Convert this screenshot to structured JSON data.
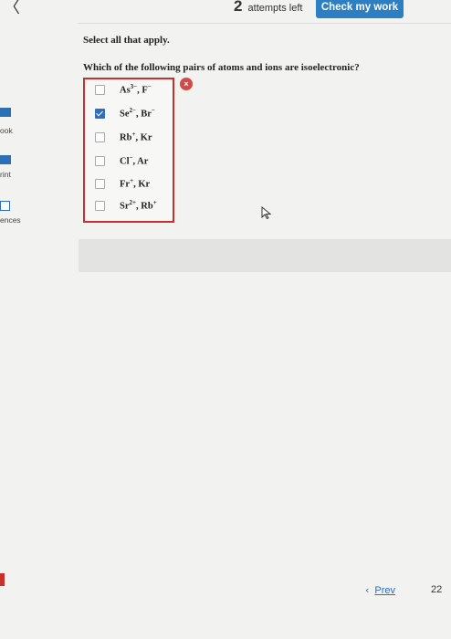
{
  "header": {
    "attempts_count": "2",
    "attempts_label": "attempts left",
    "check_button": "Check my work"
  },
  "sidebar": {
    "items": [
      {
        "label": "ook",
        "icon": "book-icon"
      },
      {
        "label": "rint",
        "icon": "print-icon"
      },
      {
        "label": "ences",
        "icon": "references-icon"
      }
    ]
  },
  "question": {
    "instruction": "Select all that apply.",
    "text": "Which of the following pairs of atoms and ions are isoelectronic?",
    "options": [
      {
        "a": "As",
        "a_sup": "3−",
        "sep": ", ",
        "b": "F",
        "b_sup": "−",
        "checked": false
      },
      {
        "a": "Se",
        "a_sup": "2−",
        "sep": ", ",
        "b": "Br",
        "b_sup": "−",
        "checked": true
      },
      {
        "a": "Rb",
        "a_sup": "+",
        "sep": ", ",
        "b": "Kr",
        "b_sup": "",
        "checked": false
      },
      {
        "a": "Cl",
        "a_sup": "−",
        "sep": ", ",
        "b": "Ar",
        "b_sup": "",
        "checked": false
      },
      {
        "a": "Fr",
        "a_sup": "+",
        "sep": ", ",
        "b": "Kr",
        "b_sup": "",
        "checked": false
      },
      {
        "a": "Sr",
        "a_sup": "2+",
        "sep": ", ",
        "b": "Rb",
        "b_sup": "+",
        "checked": false
      }
    ],
    "result_mark": "×"
  },
  "footer": {
    "prev_label": "Prev",
    "page_number": "22"
  },
  "colors": {
    "accent": "#2e7ec2",
    "error": "#c8302c"
  }
}
